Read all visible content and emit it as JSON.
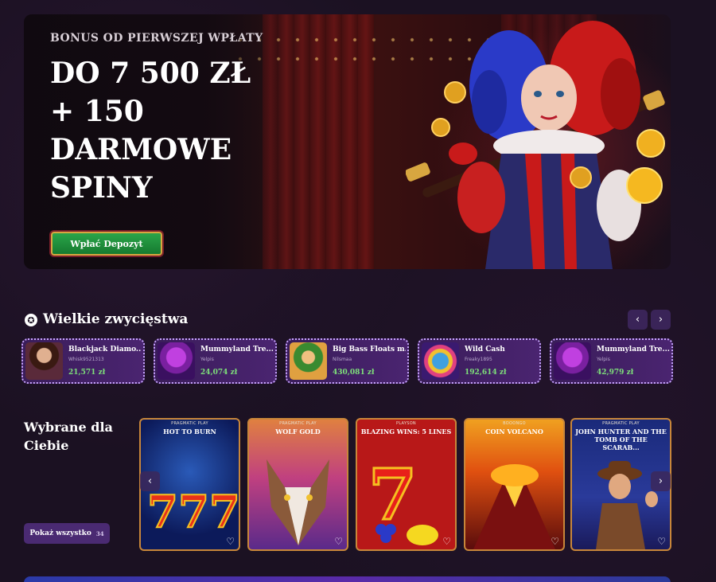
{
  "hero": {
    "eyebrow": "BONUS OD PIERWSZEJ WPŁATY",
    "headline_lines": [
      "DO 7 500 ZŁ",
      "+ 150",
      "DARMOWE",
      "SPINY"
    ],
    "cta_label": "Wpłać Depozyt"
  },
  "big_wins": {
    "title": "Wielkie zwycięstwa",
    "prev_label": "‹",
    "next_label": "›",
    "items": [
      {
        "game": "Blackjack Diamo...",
        "user": "Whisk9521313",
        "amount": "21,571 zł"
      },
      {
        "game": "Mummyland Tre...",
        "user": "Yelpis",
        "amount": "24,074 zł"
      },
      {
        "game": "Big Bass Floats m...",
        "user": "Nilsmaa",
        "amount": "430,081 zł"
      },
      {
        "game": "Wild Cash",
        "user": "Freaky1895",
        "amount": "192,614 zł"
      },
      {
        "game": "Mummyland Tre...",
        "user": "Yelpis",
        "amount": "42,979 zł"
      }
    ]
  },
  "picked": {
    "title": "Wybrane dla Ciebie",
    "show_all_label": "Pokaż wszystko",
    "show_all_count": "34",
    "prev_label": "‹",
    "next_label": "›",
    "games": [
      {
        "provider": "PRAGMATIC PLAY",
        "name": "HOT TO BURN"
      },
      {
        "provider": "PRAGMATIC PLAY",
        "name": "WOLF GOLD"
      },
      {
        "provider": "PLAYSON",
        "name": "BLAZING WINS: 5 LINES"
      },
      {
        "provider": "BOOONGO",
        "name": "COIN VOLCANO"
      },
      {
        "provider": "PRAGMATIC PLAY",
        "name": "JOHN HUNTER AND THE TOMB OF THE SCARAB..."
      }
    ]
  },
  "icons": {
    "heart": "♡",
    "star": "✪"
  }
}
